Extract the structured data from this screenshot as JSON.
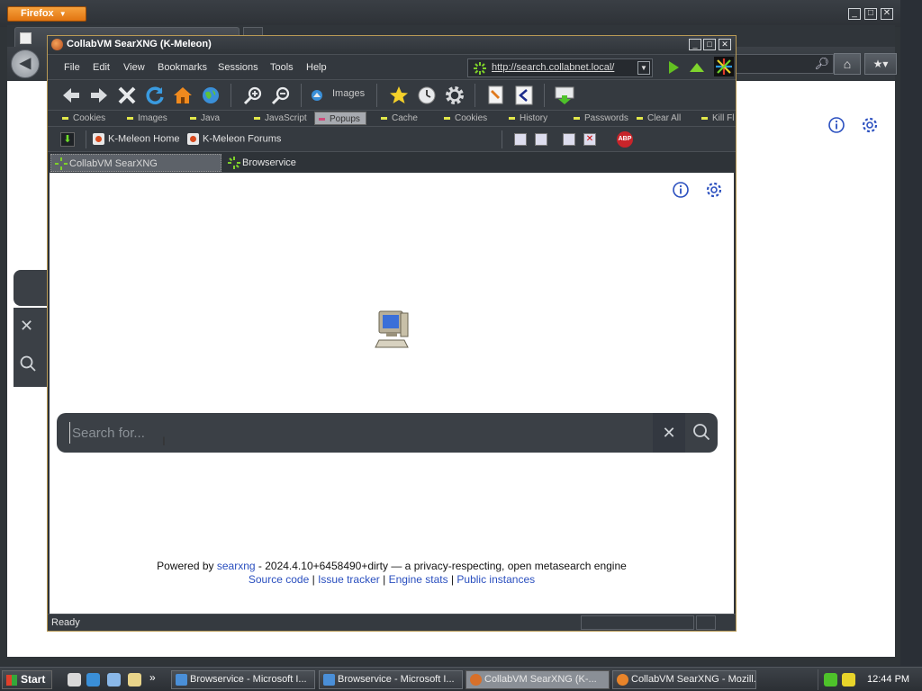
{
  "firefox": {
    "menu_button": "Firefox",
    "tab_title": "",
    "window_controls": [
      "minimize",
      "maximize",
      "close"
    ]
  },
  "kmeleon": {
    "title": "CollabVM SearXNG (K-Meleon)",
    "menu": [
      "File",
      "Edit",
      "View",
      "Bookmarks",
      "Sessions",
      "Tools",
      "Help"
    ],
    "url": "http://search.collabnet.local/",
    "toolbar": {
      "images_label": "Images"
    },
    "prefbar": [
      "Cookies",
      "Images",
      "Java",
      "JavaScript",
      "Popups",
      "Cache",
      "Cookies",
      "History",
      "Passwords",
      "Clear All",
      "Kill Fl"
    ],
    "bookmarks": [
      "K-Meleon Home",
      "K-Meleon Forums"
    ],
    "tabs": [
      "CollabVM SearXNG",
      "Browservice"
    ],
    "status": "Ready"
  },
  "page": {
    "search_placeholder": "Search for...",
    "footer": {
      "powered_prefix": "Powered by ",
      "searxng_link": "searxng",
      "powered_suffix": " - 2024.4.10+6458490+dirty — a privacy-respecting, open metasearch engine",
      "links": [
        "Source code",
        "Issue tracker",
        "Engine stats",
        "Public instances"
      ],
      "separator": " | "
    }
  },
  "taskbar": {
    "start_label": "Start",
    "tasks": [
      "Browservice - Microsoft I...",
      "Browservice - Microsoft I...",
      "CollabVM SearXNG (K-...",
      "CollabVM SearXNG - Mozill..."
    ],
    "overflow": "»",
    "clock": "12:44 PM"
  },
  "colors": {
    "searxng_link": "#2a4fbf",
    "search_bar": "#3b4046",
    "firefox_button": "#e27410"
  },
  "icons": [
    "back-arrow-icon",
    "forward-arrow-icon",
    "stop-icon",
    "reload-icon",
    "home-icon",
    "globe-icon",
    "zoom-in-icon",
    "zoom-out-icon",
    "star-icon",
    "history-clock-icon",
    "gear-icon",
    "info-icon",
    "search-icon",
    "close-icon",
    "computer-icon",
    "adblock-icon"
  ]
}
